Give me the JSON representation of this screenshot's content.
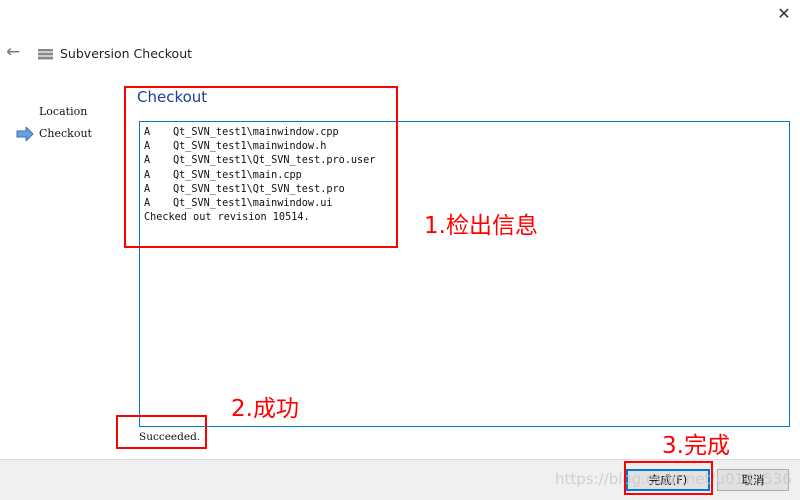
{
  "window": {
    "title": "Subversion Checkout",
    "close_icon": "close-icon",
    "back_icon": "back-arrow-icon"
  },
  "nav": {
    "items": [
      {
        "label": "Location"
      },
      {
        "label": "Checkout",
        "active": true
      }
    ]
  },
  "main": {
    "heading": "Checkout",
    "log": [
      {
        "action": "A",
        "path": "Qt_SVN_test1\\mainwindow.cpp"
      },
      {
        "action": "A",
        "path": "Qt_SVN_test1\\mainwindow.h"
      },
      {
        "action": "A",
        "path": "Qt_SVN_test1\\Qt_SVN_test.pro.user"
      },
      {
        "action": "A",
        "path": "Qt_SVN_test1\\main.cpp"
      },
      {
        "action": "A",
        "path": "Qt_SVN_test1\\Qt_SVN_test.pro"
      },
      {
        "action": "A",
        "path": "Qt_SVN_test1\\mainwindow.ui"
      }
    ],
    "summary": "Checked out revision 10514.",
    "status": "Succeeded."
  },
  "footer": {
    "finish_label": "完成(F)",
    "cancel_label": "取消"
  },
  "annotations": {
    "a1": "1.检出信息",
    "a2": "2.成功",
    "a3": "3.完成",
    "color": "#ff0000"
  },
  "watermark": "https://blog.csdn.net/u014..536"
}
